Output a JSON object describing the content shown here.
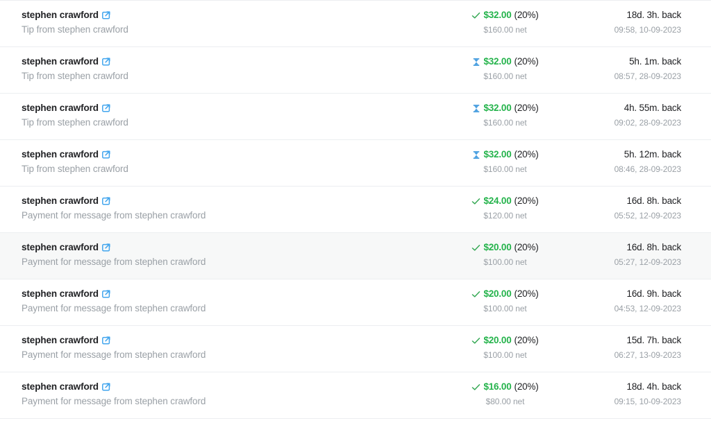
{
  "list": {
    "name": "earnings-transactions-list",
    "colors": {
      "amount_green": "#24b34b",
      "pending_blue": "#4a9fe0",
      "approved_green": "#34a853",
      "link_blue": "#41a5ee",
      "muted_text": "#9aa0a6",
      "primary_text": "#202124",
      "row_border": "#eceef0",
      "row_highlight_bg": "#f7f8f8"
    },
    "rows": [
      {
        "source_name": "stephen crawford",
        "link_icon": "external-link-icon",
        "description": "Tip from stephen crawford",
        "status_icon": "check-icon",
        "status": "approved",
        "amount": "$32.00",
        "percent": "(20%)",
        "net": "$160.00 net",
        "time_relative": "18d. 3h. back",
        "time_absolute": "09:58, 10-09-2023",
        "highlighted": false
      },
      {
        "source_name": "stephen crawford",
        "link_icon": "external-link-icon",
        "description": "Tip from stephen crawford",
        "status_icon": "hourglass-icon",
        "status": "pending",
        "amount": "$32.00",
        "percent": "(20%)",
        "net": "$160.00 net",
        "time_relative": "5h. 1m. back",
        "time_absolute": "08:57, 28-09-2023",
        "highlighted": false
      },
      {
        "source_name": "stephen crawford",
        "link_icon": "external-link-icon",
        "description": "Tip from stephen crawford",
        "status_icon": "hourglass-icon",
        "status": "pending",
        "amount": "$32.00",
        "percent": "(20%)",
        "net": "$160.00 net",
        "time_relative": "4h. 55m. back",
        "time_absolute": "09:02, 28-09-2023",
        "highlighted": false
      },
      {
        "source_name": "stephen crawford",
        "link_icon": "external-link-icon",
        "description": "Tip from stephen crawford",
        "status_icon": "hourglass-icon",
        "status": "pending",
        "amount": "$32.00",
        "percent": "(20%)",
        "net": "$160.00 net",
        "time_relative": "5h. 12m. back",
        "time_absolute": "08:46, 28-09-2023",
        "highlighted": false
      },
      {
        "source_name": "stephen crawford",
        "link_icon": "external-link-icon",
        "description": "Payment for message from stephen crawford",
        "status_icon": "check-icon",
        "status": "approved",
        "amount": "$24.00",
        "percent": "(20%)",
        "net": "$120.00 net",
        "time_relative": "16d. 8h. back",
        "time_absolute": "05:52, 12-09-2023",
        "highlighted": false
      },
      {
        "source_name": "stephen crawford",
        "link_icon": "external-link-icon",
        "description": "Payment for message from stephen crawford",
        "status_icon": "check-icon",
        "status": "approved",
        "amount": "$20.00",
        "percent": "(20%)",
        "net": "$100.00 net",
        "time_relative": "16d. 8h. back",
        "time_absolute": "05:27, 12-09-2023",
        "highlighted": true
      },
      {
        "source_name": "stephen crawford",
        "link_icon": "external-link-icon",
        "description": "Payment for message from stephen crawford",
        "status_icon": "check-icon",
        "status": "approved",
        "amount": "$20.00",
        "percent": "(20%)",
        "net": "$100.00 net",
        "time_relative": "16d. 9h. back",
        "time_absolute": "04:53, 12-09-2023",
        "highlighted": false
      },
      {
        "source_name": "stephen crawford",
        "link_icon": "external-link-icon",
        "description": "Payment for message from stephen crawford",
        "status_icon": "check-icon",
        "status": "approved",
        "amount": "$20.00",
        "percent": "(20%)",
        "net": "$100.00 net",
        "time_relative": "15d. 7h. back",
        "time_absolute": "06:27, 13-09-2023",
        "highlighted": false
      },
      {
        "source_name": "stephen crawford",
        "link_icon": "external-link-icon",
        "description": "Payment for message from stephen crawford",
        "status_icon": "check-icon",
        "status": "approved",
        "amount": "$16.00",
        "percent": "(20%)",
        "net": "$80.00 net",
        "time_relative": "18d. 4h. back",
        "time_absolute": "09:15, 10-09-2023",
        "highlighted": false
      }
    ]
  }
}
